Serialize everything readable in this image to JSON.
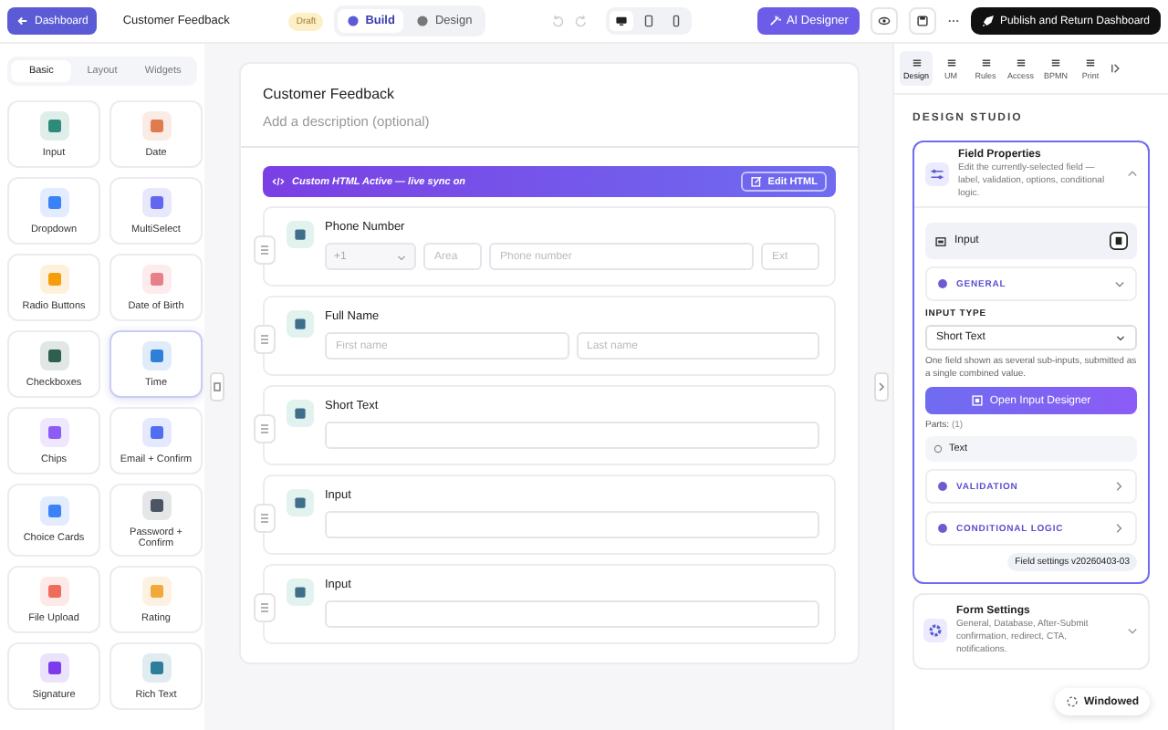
{
  "topbar": {
    "back_button": "Dashboard",
    "title": "Customer Feedback",
    "badge": "Draft",
    "modes": [
      {
        "label": "Build",
        "selected": true
      },
      {
        "label": "Design",
        "selected": false
      }
    ],
    "devices": [
      {
        "kind": "desktop",
        "selected": true
      },
      {
        "kind": "tablet",
        "selected": false
      },
      {
        "kind": "phone",
        "selected": false
      }
    ],
    "ai_button": "AI Designer",
    "publish_button": "Publish and Return Dashboard"
  },
  "palette": {
    "tabs": [
      {
        "label": "Basic",
        "selected": true
      },
      {
        "label": "Layout",
        "selected": false
      },
      {
        "label": "Widgets",
        "selected": false
      }
    ],
    "items": [
      {
        "label": "Input",
        "color": "#2e8b7a",
        "selected": false
      },
      {
        "label": "Date",
        "color": "#e07b4f",
        "selected": false
      },
      {
        "label": "Dropdown",
        "color": "#3b82f6",
        "selected": false
      },
      {
        "label": "MultiSelect",
        "color": "#6366f1",
        "selected": false
      },
      {
        "label": "Radio Buttons",
        "color": "#f59e0b",
        "selected": false
      },
      {
        "label": "Date of Birth",
        "color": "#e8808a",
        "selected": false
      },
      {
        "label": "Checkboxes",
        "color": "#2f5d50",
        "selected": false
      },
      {
        "label": "Time",
        "color": "#2f7fd8",
        "selected": true
      },
      {
        "label": "Chips",
        "color": "#8b5cf6",
        "selected": false
      },
      {
        "label": "Email + Confirm",
        "color": "#4f6ef0",
        "selected": false
      },
      {
        "label": "Choice Cards",
        "color": "#3b82f6",
        "selected": false
      },
      {
        "label": "Password + Confirm",
        "color": "#4b5563",
        "selected": false
      },
      {
        "label": "File Upload",
        "color": "#ef6b5b",
        "selected": false
      },
      {
        "label": "Rating",
        "color": "#f2a93b",
        "selected": false
      },
      {
        "label": "Signature",
        "color": "#7c3aed",
        "selected": false
      },
      {
        "label": "Rich Text",
        "color": "#2e7d9a",
        "selected": false
      }
    ]
  },
  "canvas": {
    "title": "Customer Feedback",
    "description_placeholder": "Add a description (optional)",
    "banner": {
      "text": "Custom HTML Active — live sync on",
      "button": "Edit HTML"
    },
    "fields": [
      {
        "kind": "phone",
        "label": "Phone Number",
        "country_code": "+1",
        "inputs": [
          {
            "placeholder": "Area"
          },
          {
            "placeholder": "Phone number"
          },
          {
            "placeholder": "Ext"
          }
        ]
      },
      {
        "kind": "name",
        "label": "Full Name",
        "inputs": [
          {
            "placeholder": "First name"
          },
          {
            "placeholder": "Last name"
          }
        ]
      },
      {
        "kind": "text",
        "label": "Short Text"
      },
      {
        "kind": "text",
        "label": "Input"
      },
      {
        "kind": "text",
        "label": "Input"
      }
    ]
  },
  "panel": {
    "tabs": [
      {
        "label": "Design",
        "selected": true
      },
      {
        "label": "UM",
        "selected": false
      },
      {
        "label": "Rules",
        "selected": false
      },
      {
        "label": "Access",
        "selected": false
      },
      {
        "label": "BPMN",
        "selected": false
      },
      {
        "label": "Print",
        "selected": false
      }
    ],
    "heading": "DESIGN STUDIO",
    "field_properties": {
      "title": "Field Properties",
      "description": "Edit the currently-selected field — label, validation, options, conditional logic.",
      "expanded": true,
      "selected_field": "Input",
      "sections": [
        {
          "label": "GENERAL",
          "expanded": true
        },
        {
          "label": "VALIDATION",
          "expanded": false
        },
        {
          "label": "CONDITIONAL LOGIC",
          "expanded": false
        }
      ],
      "input_type_label": "INPUT TYPE",
      "input_type": "Short Text",
      "help": "One field shown as several sub-inputs, submitted as a single combined value.",
      "designer_button": "Open Input Designer",
      "parts_label": "Parts:",
      "parts_count": "(1)",
      "parts": [
        {
          "label": "Text"
        }
      ],
      "version": "Field settings v20260403-03"
    },
    "form_settings": {
      "title": "Form Settings",
      "description": "General, Database, After-Submit confirmation, redirect, CTA, notifications."
    },
    "windowed_button": "Windowed"
  }
}
